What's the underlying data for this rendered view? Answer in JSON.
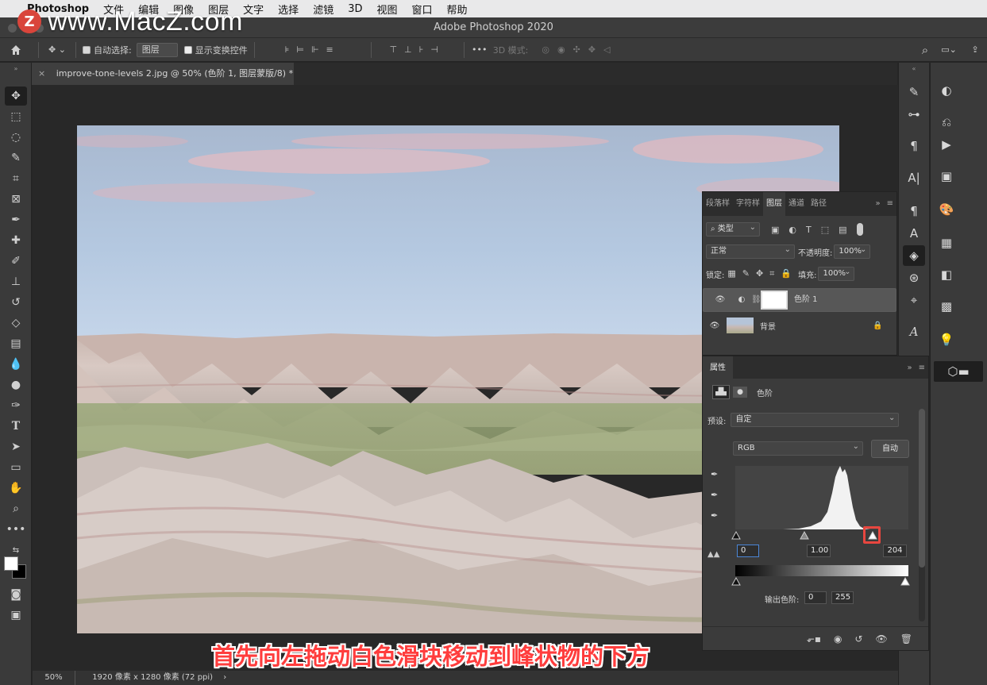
{
  "menubar": {
    "apple_icon": "apple-icon",
    "app_name": "Photoshop",
    "menus": [
      "文件",
      "编辑",
      "图像",
      "图层",
      "文字",
      "选择",
      "滤镜",
      "3D",
      "视图",
      "窗口",
      "帮助"
    ]
  },
  "watermark": {
    "badge": "Z",
    "text": "www.MacZ.com"
  },
  "window": {
    "title": "Adobe Photoshop 2020"
  },
  "options_bar": {
    "auto_select_label": "自动选择:",
    "auto_select_value": "图层",
    "show_transform_label": "显示变换控件",
    "mode_3d_label": "3D 模式:"
  },
  "document": {
    "tab_title": "improve-tone-levels 2.jpg @ 50% (色阶 1, 图层蒙版/8) *",
    "zoom": "50%",
    "info": "1920 像素 x 1280 像素 (72 ppi)"
  },
  "layers_panel": {
    "tabs": [
      "段落样",
      "字符样",
      "图层",
      "通道",
      "路径"
    ],
    "active_tab": "图层",
    "filter_kind": "类型",
    "blend_mode": "正常",
    "opacity_label": "不透明度:",
    "opacity_value": "100%",
    "lock_label": "锁定:",
    "fill_label": "填充:",
    "fill_value": "100%",
    "layers": [
      {
        "name": "色阶 1",
        "selected": true
      },
      {
        "name": "背景",
        "selected": false
      }
    ]
  },
  "properties_panel": {
    "tab": "属性",
    "adjustment_name": "色阶",
    "preset_label": "预设:",
    "preset_value": "自定",
    "channel": "RGB",
    "auto_button": "自动",
    "input_black": "0",
    "input_gamma": "1.00",
    "input_white": "204",
    "output_label": "输出色阶:",
    "output_black": "0",
    "output_white": "255"
  },
  "caption": "首先向左拖动白色滑块移动到峰状物的下方",
  "colors": {
    "accent_highlight": "#e8463f",
    "panel_bg": "#3b3b3b",
    "caption_red": "#ff3d3d"
  }
}
